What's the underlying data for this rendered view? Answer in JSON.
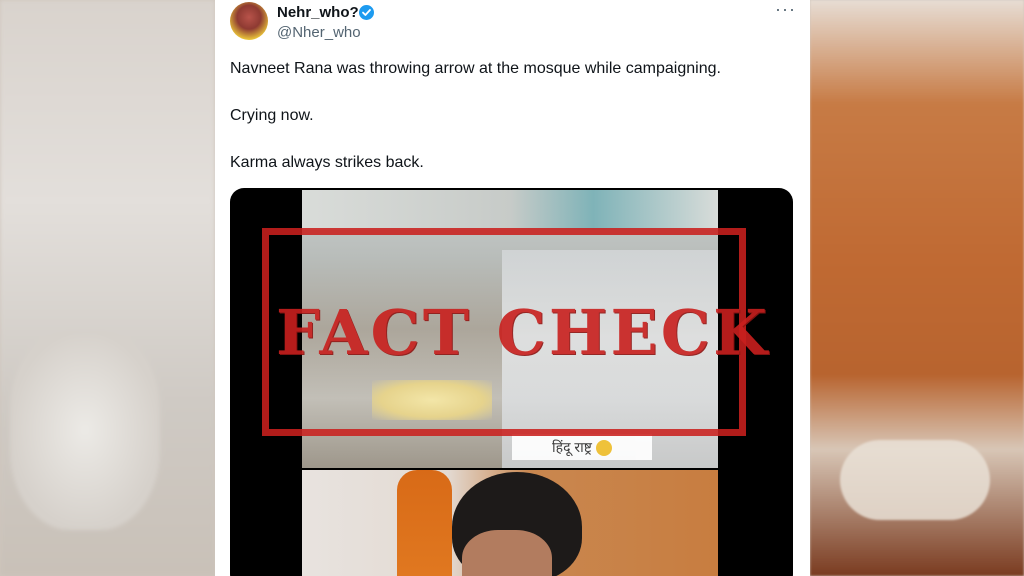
{
  "tweet": {
    "author_name": "Nehr_who?",
    "author_handle": "@Nher_who",
    "more_icon": "more-horizontal-icon",
    "verified_icon": "verified-badge-icon",
    "text_lines": [
      "Navneet Rana was throwing arrow at the mosque while campaigning.",
      "Crying now.",
      "Karma always strikes back."
    ]
  },
  "media": {
    "caption": "हिंदू राष्ट्र"
  },
  "stamp": {
    "text": "FACT CHECK",
    "color": "#c9201e"
  },
  "colors": {
    "verified": "#1d9bf0",
    "handle": "#536471",
    "text": "#0f1419"
  }
}
